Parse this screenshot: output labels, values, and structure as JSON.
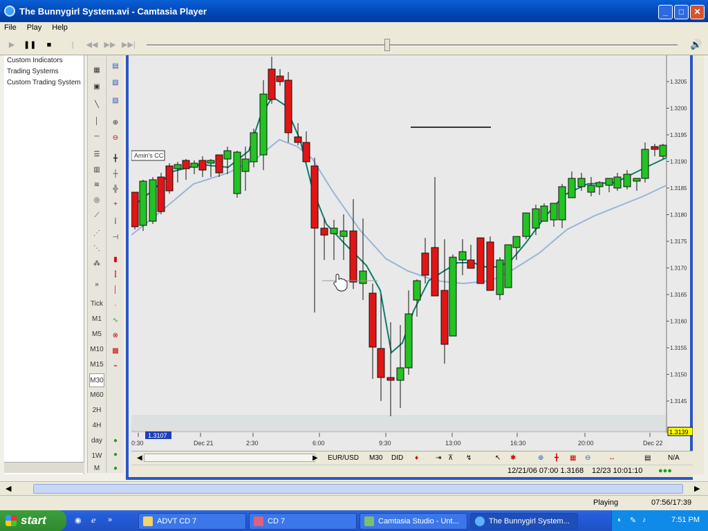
{
  "window": {
    "title": "The Bunnygirl System.avi - Camtasia Player"
  },
  "menu": [
    "File",
    "Play",
    "Help"
  ],
  "nav_items": [
    "Custom Indicators",
    "Trading Systems",
    "Custom Trading System"
  ],
  "timeframes": [
    "Tick",
    "M1",
    "M5",
    "M10",
    "M15",
    "M30",
    "M60",
    "2H",
    "4H",
    "day",
    "1W",
    "M"
  ],
  "chart": {
    "time_labels": [
      "0:30",
      "Dec 21",
      "2:30",
      "6:00",
      "9:30",
      "13:00",
      "16:30",
      "20:00",
      "Dec 22"
    ],
    "price_labels": [
      "1.3205",
      "1.3200",
      "1.3195",
      "1.3190",
      "1.3185",
      "1.3180",
      "1.3175",
      "1.3170",
      "1.3165",
      "1.3160",
      "1.3155",
      "1.3150",
      "1.3145"
    ],
    "current_price": "1.3139",
    "marker_price": "1.3107",
    "annotation": "Amin's CC",
    "symbol": "EUR/USD",
    "period": "M30",
    "mode": "DID",
    "na": "N/A",
    "status_left": "12/21/06 07:00  1.3168",
    "status_right": "12/23 10:01:10"
  },
  "chart_data": {
    "type": "candlestick",
    "x": [
      "0:30",
      "Dec 21",
      "2:30",
      "6:00",
      "9:30",
      "13:00",
      "16:30",
      "20:00",
      "Dec 22"
    ],
    "ylim": [
      1.314,
      1.321
    ]
  },
  "status": {
    "state": "Playing",
    "time": "07:56/17:39"
  },
  "taskbar": {
    "start": "start",
    "tasks": [
      "ADVT CD 7",
      "CD 7",
      "Camtasia Studio - Unt...",
      "The Bunnygirl System..."
    ],
    "clock": "7:51 PM"
  },
  "colors": {
    "up": "#22c322",
    "down": "#e01515",
    "ma_fast": "#0d7a6a",
    "ma_slow": "#98b4d8"
  }
}
